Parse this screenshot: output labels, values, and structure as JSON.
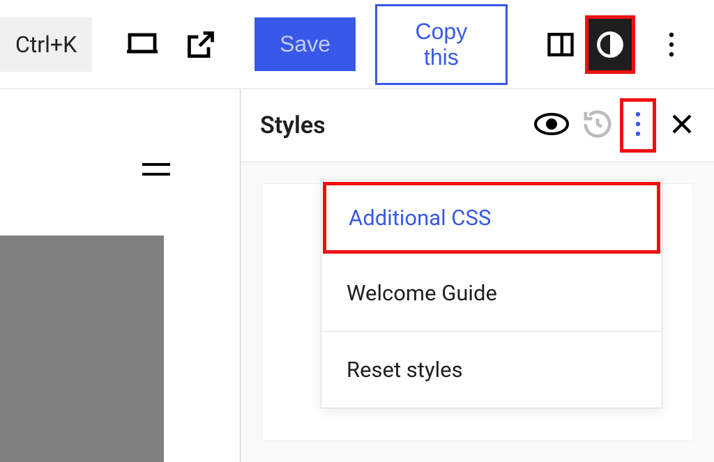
{
  "toolbar": {
    "shortcut": "Ctrl+K",
    "save_label": "Save",
    "copy_label": "Copy this"
  },
  "panel": {
    "title": "Styles",
    "menu": {
      "additional_css": "Additional CSS",
      "welcome_guide": "Welcome Guide",
      "reset_styles": "Reset styles"
    }
  }
}
